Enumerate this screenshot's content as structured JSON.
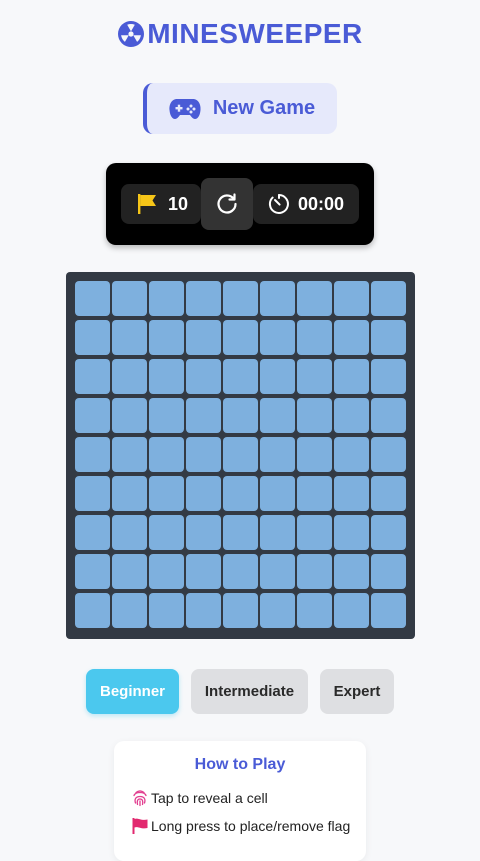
{
  "app": {
    "title": "MINESWEEPER",
    "title_icon": "radiation-icon",
    "accent_color": "#4a5bd6"
  },
  "new_game": {
    "label": "New Game",
    "icon": "gamepad-icon"
  },
  "status": {
    "flags_icon": "flag-icon",
    "flags_count": "10",
    "reset_icon": "refresh-icon",
    "timer_icon": "timer-icon",
    "timer": "00:00"
  },
  "board": {
    "rows": 9,
    "cols": 9,
    "cell_state": "unrevealed",
    "cell_color": "#7eb0de"
  },
  "difficulty": {
    "options": [
      "Beginner",
      "Intermediate",
      "Expert"
    ],
    "selected": "Beginner"
  },
  "how_to_play": {
    "title": "How to Play",
    "items": [
      {
        "icon": "fingerprint-icon",
        "text": "Tap to reveal a cell"
      },
      {
        "icon": "flag-icon",
        "text": "Long press to place/remove flag"
      }
    ]
  }
}
